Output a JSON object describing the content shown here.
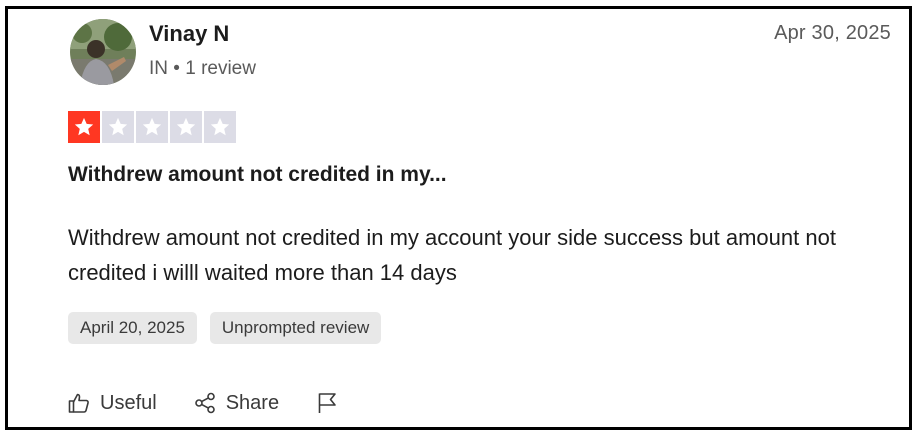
{
  "review": {
    "author": {
      "name": "Vinay N",
      "country": "IN",
      "separator": "•",
      "review_count": "1 review",
      "avatar": "user-photo-avatar"
    },
    "posted_date": "Apr 30, 2025",
    "rating": {
      "value": 1,
      "max": 5,
      "filled_color": "#ff3722",
      "empty_color": "#dcdce6"
    },
    "title": "Withdrew amount not credited in my...",
    "body": "Withdrew amount not credited in my account your side success but amount not credited i willl waited more than 14 days",
    "tags": [
      "April 20, 2025",
      "Unprompted review"
    ],
    "actions": {
      "useful_label": "Useful",
      "useful_icon": "thumbs-up-icon",
      "share_label": "Share",
      "share_icon": "share-icon",
      "flag_icon": "flag-icon"
    }
  }
}
